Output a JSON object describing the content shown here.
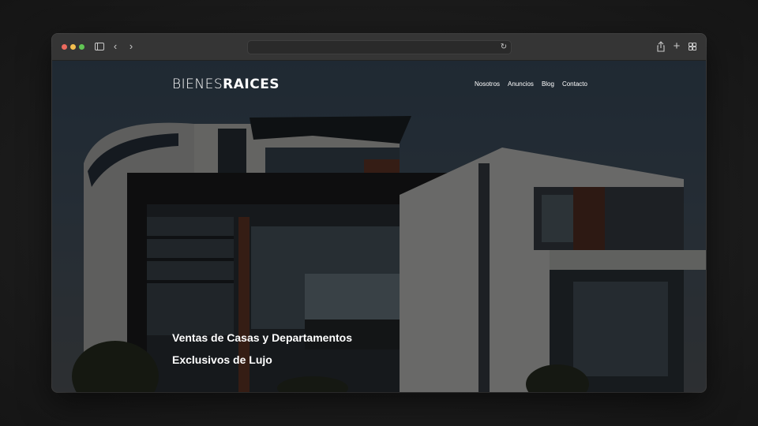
{
  "browser": {
    "address_value": "",
    "icons": [
      "sidebar-icon",
      "back-icon",
      "forward-icon",
      "reload-icon",
      "share-icon",
      "new-tab-icon",
      "tab-overview-icon"
    ]
  },
  "site": {
    "logo_light": "BIENES",
    "logo_bold": "RAICES",
    "nav": [
      {
        "label": "Nosotros"
      },
      {
        "label": "Anuncios"
      },
      {
        "label": "Blog"
      },
      {
        "label": "Contacto"
      }
    ],
    "hero": {
      "line1": "Ventas de Casas y Departamentos",
      "line2": "Exclusivos de Lujo"
    }
  }
}
